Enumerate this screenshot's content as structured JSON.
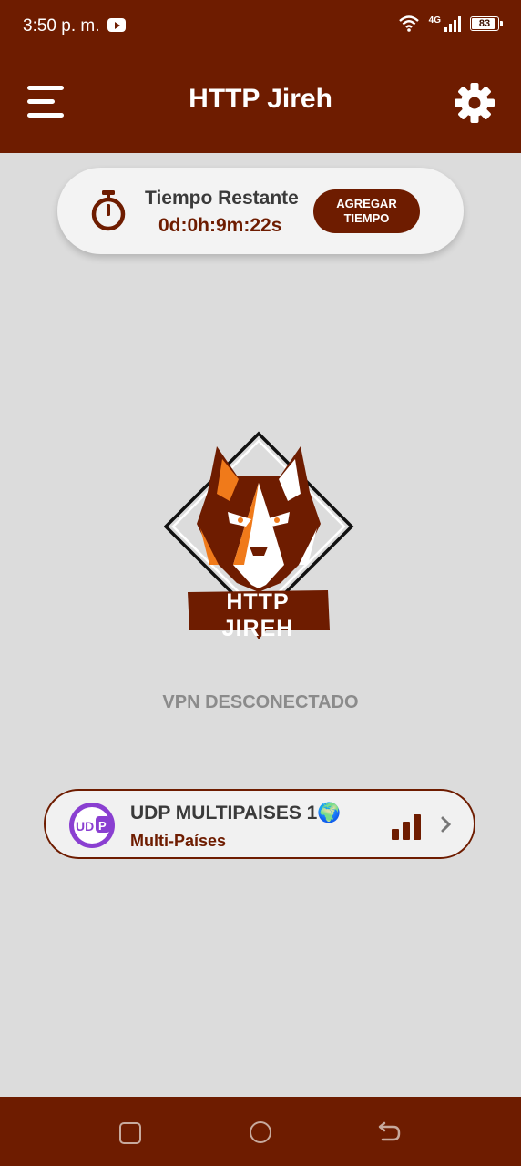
{
  "status_bar": {
    "time": "3:50 p. m.",
    "network": "4G",
    "battery": "83",
    "battery_level": 0.83,
    "icons": [
      "youtube-icon",
      "wifi-icon",
      "signal-icon",
      "battery-icon"
    ]
  },
  "header": {
    "title": "HTTP Jireh",
    "menu_icon": "menu-icon",
    "settings_icon": "gear-icon"
  },
  "timer": {
    "label": "Tiempo Restante",
    "value": "0d:0h:9m:22s",
    "button_label": "AGREGAR\nTIEMPO",
    "icon": "stopwatch-icon"
  },
  "logo": {
    "text": "HTTP JIREH"
  },
  "vpn": {
    "status": "VPN DESCONECTADO"
  },
  "server": {
    "name": "UDP MULTIPAISES 1🌍",
    "subtitle": "Multi-Países",
    "icon_text": "UD",
    "icon_badge": "P"
  },
  "colors": {
    "primary": "#6e1c00",
    "background": "#dcdcdc",
    "card": "#f3f3f3",
    "accent_orange": "#f07a1a",
    "udp_purple": "#8a3fd1"
  }
}
